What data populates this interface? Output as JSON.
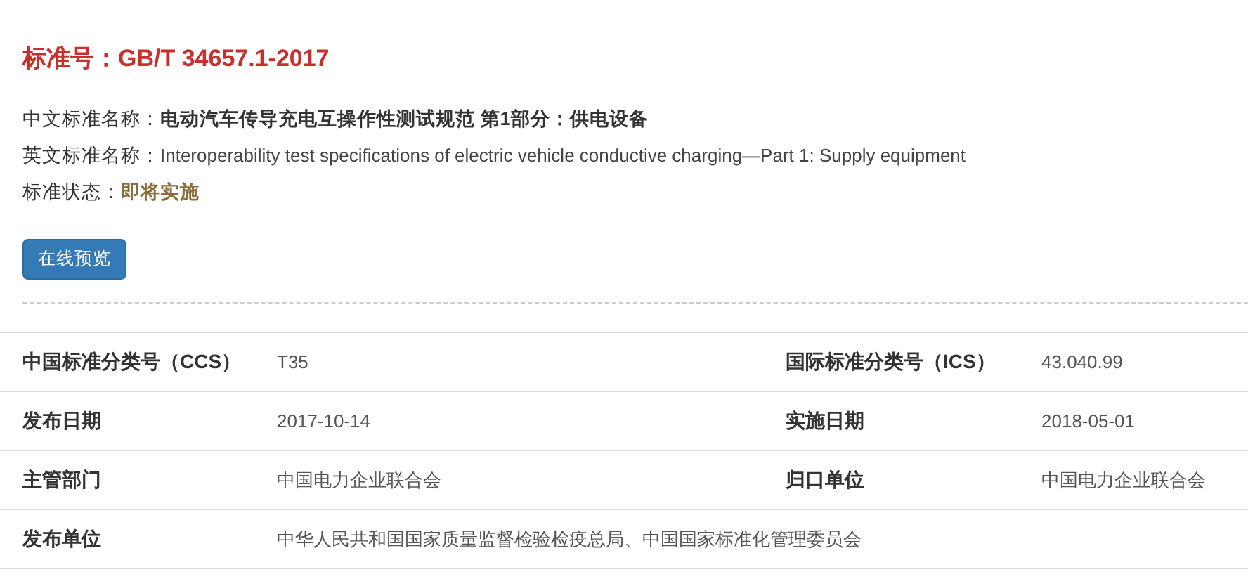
{
  "standard_number": {
    "label": "标准号：",
    "value": "GB/T 34657.1-2017"
  },
  "fields": [
    {
      "kind": "bold",
      "label": "中文标准名称：",
      "value": "电动汽车传导充电互操作性测试规范 第1部分：供电设备"
    },
    {
      "kind": "plain",
      "label": "英文标准名称：",
      "value": "Interoperability test specifications of electric vehicle conductive charging—Part 1: Supply equipment"
    },
    {
      "kind": "status",
      "label": "标准状态：",
      "value": "即将实施"
    }
  ],
  "preview_button": "在线预览",
  "table": {
    "rows": [
      {
        "cells": [
          {
            "label": "中国标准分类号（CCS）",
            "value": "T35"
          },
          {
            "label": "国际标准分类号（ICS）",
            "value": "43.040.99"
          }
        ]
      },
      {
        "cells": [
          {
            "label": "发布日期",
            "value": "2017-10-14"
          },
          {
            "label": "实施日期",
            "value": "2018-05-01"
          }
        ]
      },
      {
        "cells": [
          {
            "label": "主管部门",
            "value": "中国电力企业联合会"
          },
          {
            "label": "归口单位",
            "value": "中国电力企业联合会"
          }
        ]
      },
      {
        "cells": [
          {
            "label": "发布单位",
            "value": "中华人民共和国国家质量监督检验检疫总局、中国国家标准化管理委员会"
          }
        ]
      }
    ]
  }
}
